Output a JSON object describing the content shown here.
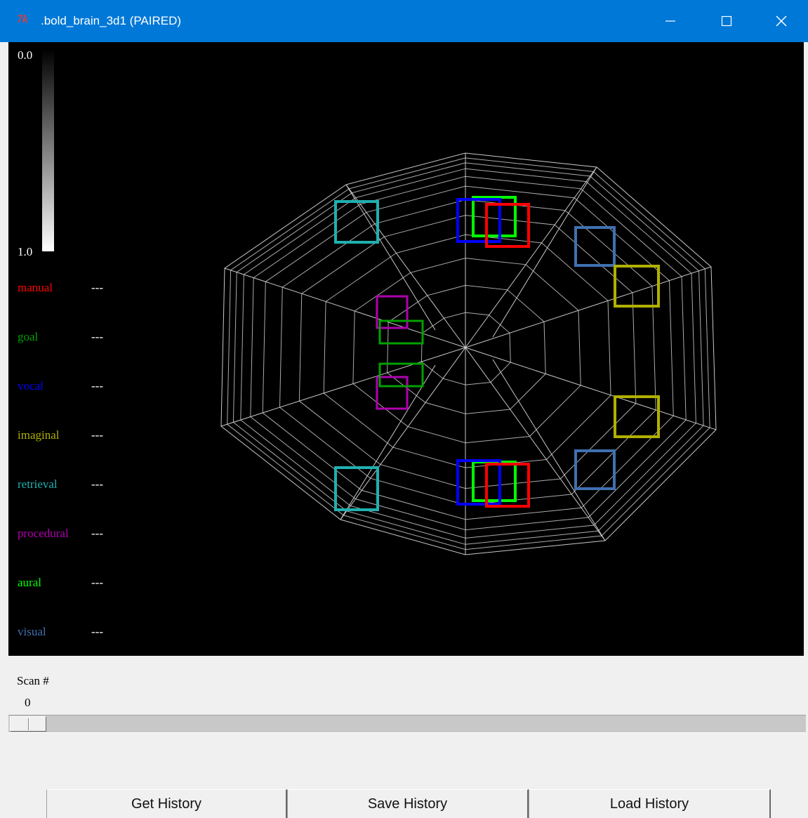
{
  "window": {
    "icon": "tk-feather-icon",
    "icon_text": "7k",
    "title": ".bold_brain_3d1 (PAIRED)"
  },
  "scale": {
    "top_label": "0.0",
    "bottom_label": "1.0"
  },
  "legend": [
    {
      "name": "manual",
      "value": "---",
      "color": "#ff0000"
    },
    {
      "name": "goal",
      "value": "---",
      "color": "#00a000"
    },
    {
      "name": "vocal",
      "value": "---",
      "color": "#0000ff"
    },
    {
      "name": "imaginal",
      "value": "---",
      "color": "#b0b000"
    },
    {
      "name": "retrieval",
      "value": "---",
      "color": "#20b0b0"
    },
    {
      "name": "procedural",
      "value": "---",
      "color": "#b000b0"
    },
    {
      "name": "aural",
      "value": "---",
      "color": "#00ff00"
    },
    {
      "name": "visual",
      "value": "---",
      "color": "#4070b0"
    }
  ],
  "scan": {
    "label": "Scan #",
    "value": "0",
    "slider_fraction": 0
  },
  "buttons": {
    "get_history": "Get History",
    "save_history": "Save History",
    "load_history": "Load History"
  },
  "colors": {
    "titlebar": "#0078d7",
    "canvas_bg": "#000000",
    "wireframe": "#c8c8c8"
  }
}
